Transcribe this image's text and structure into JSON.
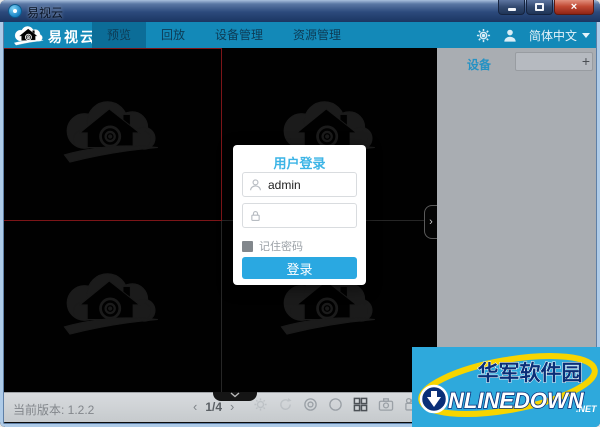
{
  "window": {
    "title": "易视云"
  },
  "nav": {
    "brand": "易视云",
    "tabs": [
      {
        "label": "预览",
        "active": true
      },
      {
        "label": "回放",
        "active": false
      },
      {
        "label": "设备管理",
        "active": false
      },
      {
        "label": "资源管理",
        "active": false
      }
    ],
    "language": "简体中文"
  },
  "device_panel": {
    "title": "设备",
    "add_button": "+"
  },
  "login": {
    "title": "用户登录",
    "username": "admin",
    "remember_label": "记住密码",
    "submit_label": "登录"
  },
  "status_bar": {
    "version_label": "当前版本: 1.2.2",
    "prev": "‹",
    "page_indicator": "1/4",
    "next": "›"
  },
  "icons": {
    "panel_collapse": "›",
    "close_button": "×"
  },
  "ad_watermark": {
    "site_name_cn": "华军软件园",
    "site_name_en": "NLINEDOWN",
    "site_tld": ".NET"
  },
  "colors": {
    "nav_bar": "#1389b8",
    "active_tab": "#0c6d98",
    "login_button": "#2aa8e1",
    "selected_tile_border": "#7c1518",
    "ad_background": "#2ea9dc"
  }
}
